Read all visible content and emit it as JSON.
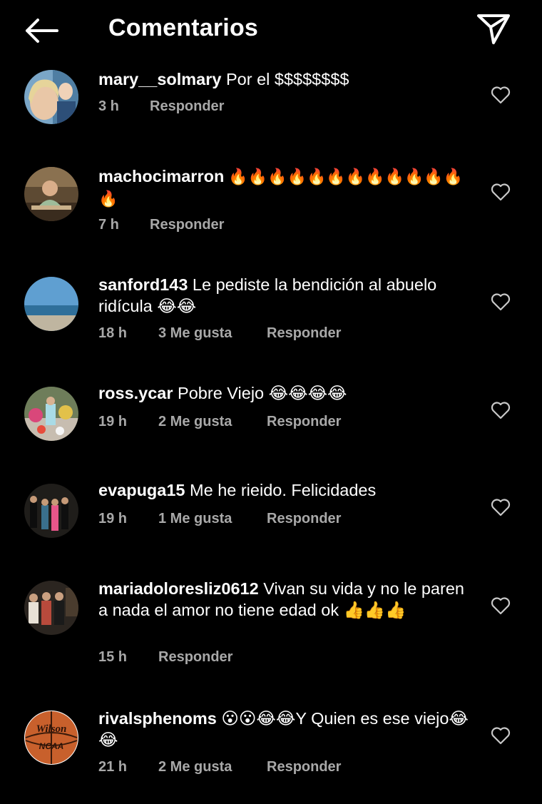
{
  "header": {
    "title": "Comentarios"
  },
  "comments": [
    {
      "username": "mary__solmary",
      "text": " Por el $$$$$$$$",
      "time": "3 h",
      "likes": "",
      "reply": "Responder"
    },
    {
      "username": "machocimarron",
      "text": " 🔥🔥🔥🔥🔥🔥🔥🔥🔥🔥🔥🔥🔥",
      "time": "7 h",
      "likes": "",
      "reply": "Responder"
    },
    {
      "username": "sanford143",
      "text": " Le pediste la bendición al abuelo ridícula 😂😂",
      "time": "18 h",
      "likes": "3 Me gusta",
      "reply": "Responder"
    },
    {
      "username": "ross.ycar",
      "text": " Pobre Viejo 😂😂😂😂",
      "time": "19 h",
      "likes": "2 Me gusta",
      "reply": "Responder"
    },
    {
      "username": "evapuga15",
      "text": " Me he rieido.  Felicidades",
      "time": "19 h",
      "likes": "1 Me gusta",
      "reply": "Responder"
    },
    {
      "username": "mariadoloresliz0612",
      "text": " Vivan su vida y no le paren a nada el amor no tiene edad ok 👍👍👍",
      "time": "15 h",
      "likes": "",
      "reply": "Responder"
    },
    {
      "username": "rivalsphenoms",
      "text": " 😮😮😂😂Y Quien es ese viejo😂😂",
      "time": "21 h",
      "likes": "2 Me gusta",
      "reply": "Responder"
    }
  ],
  "avatars": {
    "rivalsphenoms_logo_text_top": "Wilson",
    "rivalsphenoms_logo_text_bottom": "NCAA"
  }
}
